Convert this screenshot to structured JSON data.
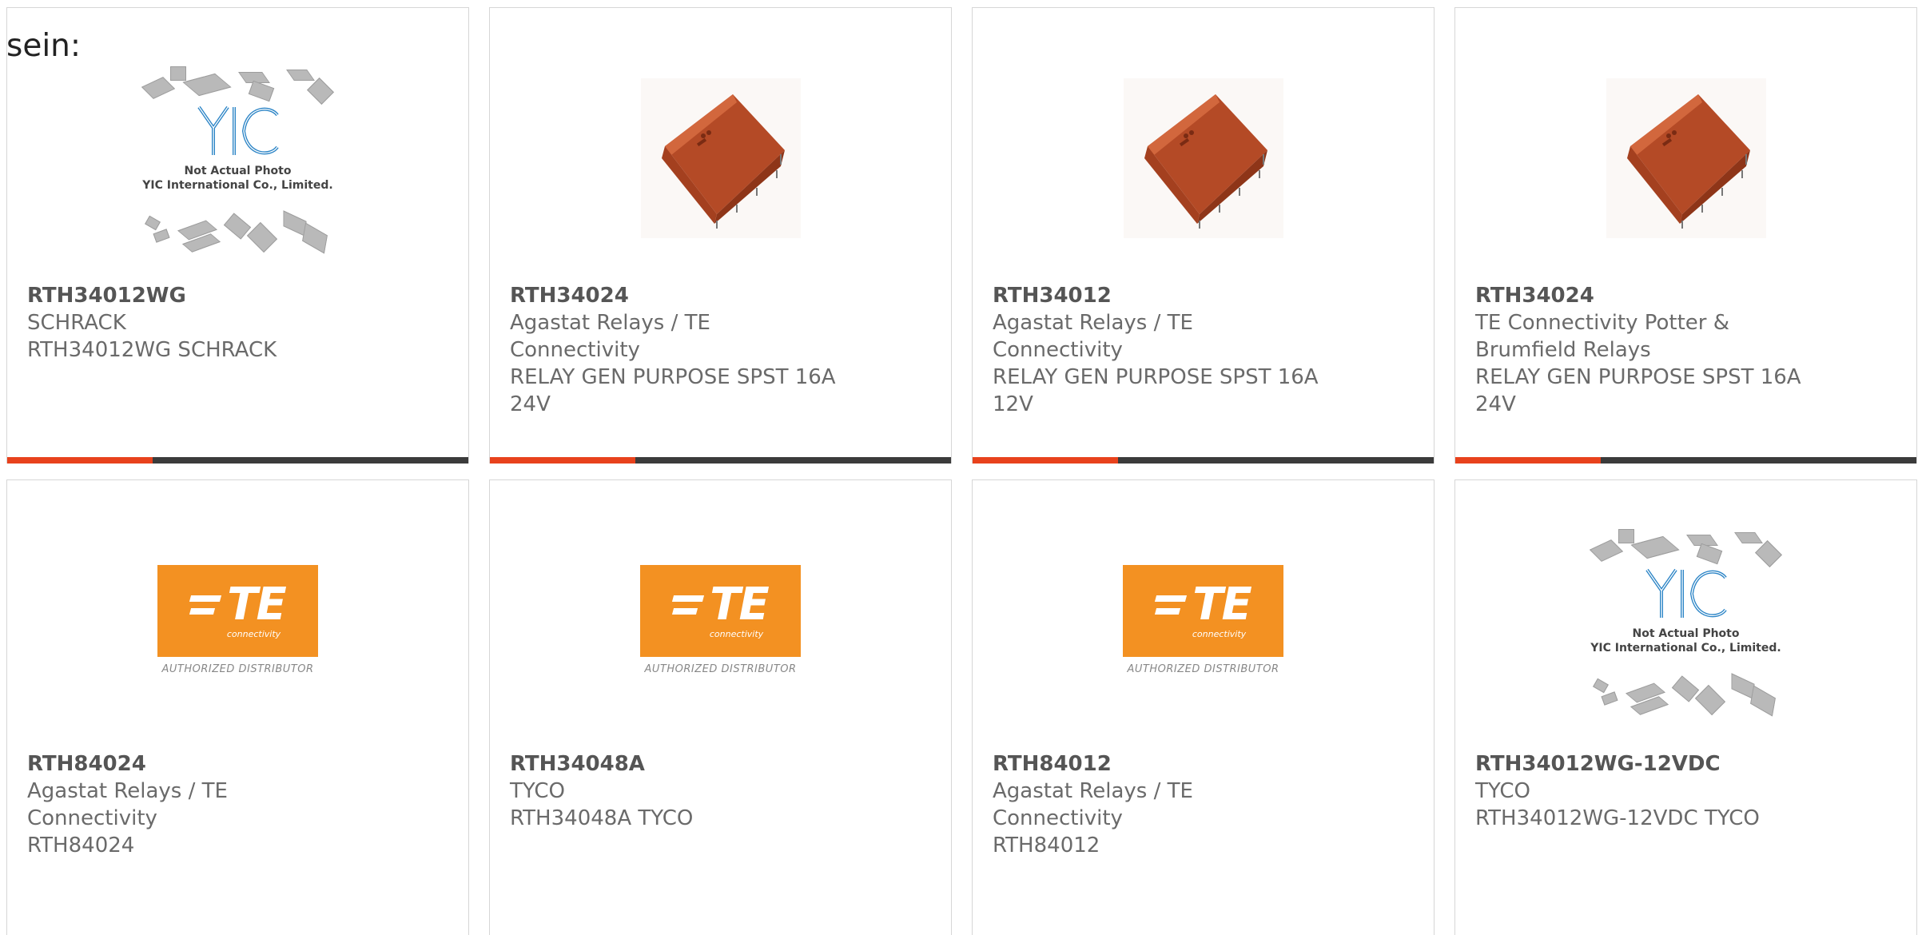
{
  "intro_text": "sein:",
  "colors": {
    "accent": "#e8421c",
    "bar": "#3b3b3b",
    "te_orange": "#f39122",
    "relay": "#c1542c"
  },
  "placeholder": {
    "line1": "Not Actual Photo",
    "line2": "YIC International Co., Limited."
  },
  "te_logo": {
    "letters": "TE",
    "sub": "connectivity",
    "caption": "AUTHORIZED DISTRIBUTOR"
  },
  "products": [
    {
      "part": "RTH34012WG",
      "lines": [
        "SCHRACK",
        "RTH34012WG SCHRACK"
      ],
      "image": "not-actual-photo"
    },
    {
      "part": "RTH34024",
      "lines": [
        "Agastat Relays / TE Connectivity",
        "RELAY GEN PURPOSE SPST 16A",
        "24V"
      ],
      "image": "relay"
    },
    {
      "part": "RTH34012",
      "lines": [
        "Agastat Relays / TE Connectivity",
        "RELAY GEN PURPOSE SPST 16A",
        "12V"
      ],
      "image": "relay"
    },
    {
      "part": "RTH34024",
      "lines": [
        "TE Connectivity Potter &",
        "Brumfield Relays",
        "RELAY GEN PURPOSE SPST 16A",
        "24V"
      ],
      "image": "relay"
    },
    {
      "part": "RTH84024",
      "lines": [
        "Agastat Relays / TE Connectivity",
        "RTH84024"
      ],
      "image": "te-logo"
    },
    {
      "part": "RTH34048A",
      "lines": [
        "TYCO",
        "RTH34048A TYCO"
      ],
      "image": "te-logo"
    },
    {
      "part": "RTH84012",
      "lines": [
        "Agastat Relays / TE Connectivity",
        "RTH84012"
      ],
      "image": "te-logo"
    },
    {
      "part": "RTH34012WG-12VDC",
      "lines": [
        "TYCO",
        "RTH34012WG-12VDC TYCO"
      ],
      "image": "not-actual-photo"
    }
  ]
}
